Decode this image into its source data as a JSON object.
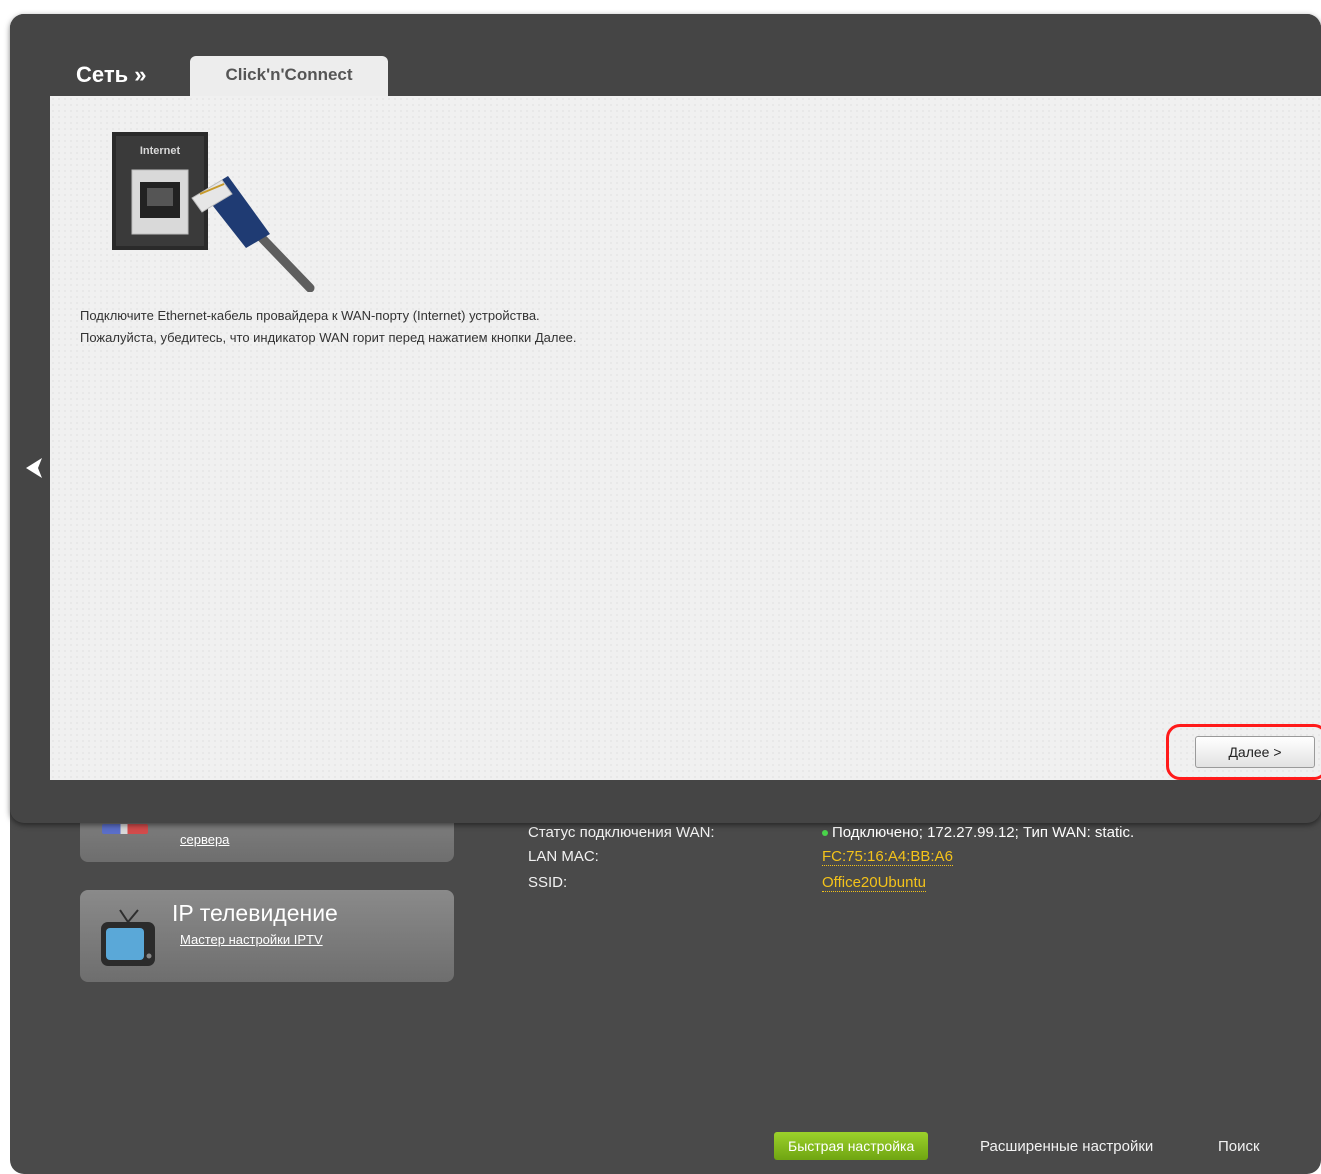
{
  "background": {
    "dns_card_link": "сервера",
    "iptv_card": {
      "title": "IP телевидение",
      "link": "Мастер настройки IPTV"
    },
    "info": {
      "wan_status_label": "Статус подключения WAN:",
      "wan_status_value": "Подключено; 172.27.99.12; Тип WAN: static.",
      "lan_mac_label": "LAN MAC:",
      "lan_mac_value": "FC:75:16:A4:BB:A6",
      "ssid_label": "SSID:",
      "ssid_value": "Office20Ubuntu"
    },
    "bottom_nav": {
      "quick_setup": "Быстрая настройка",
      "advanced": "Расширенные настройки",
      "search": "Поиск"
    }
  },
  "modal": {
    "breadcrumb": "Сеть »",
    "tab_label": "Click'n'Connect",
    "illustration_label": "Internet",
    "instruction_line1": "Подключите Ethernet-кабель провайдера к WAN-порту (Internet) устройства.",
    "instruction_line2": "Пожалуйста, убедитесь, что индикатор WAN горит перед нажатием кнопки Далее.",
    "next_button": "Далее >"
  }
}
